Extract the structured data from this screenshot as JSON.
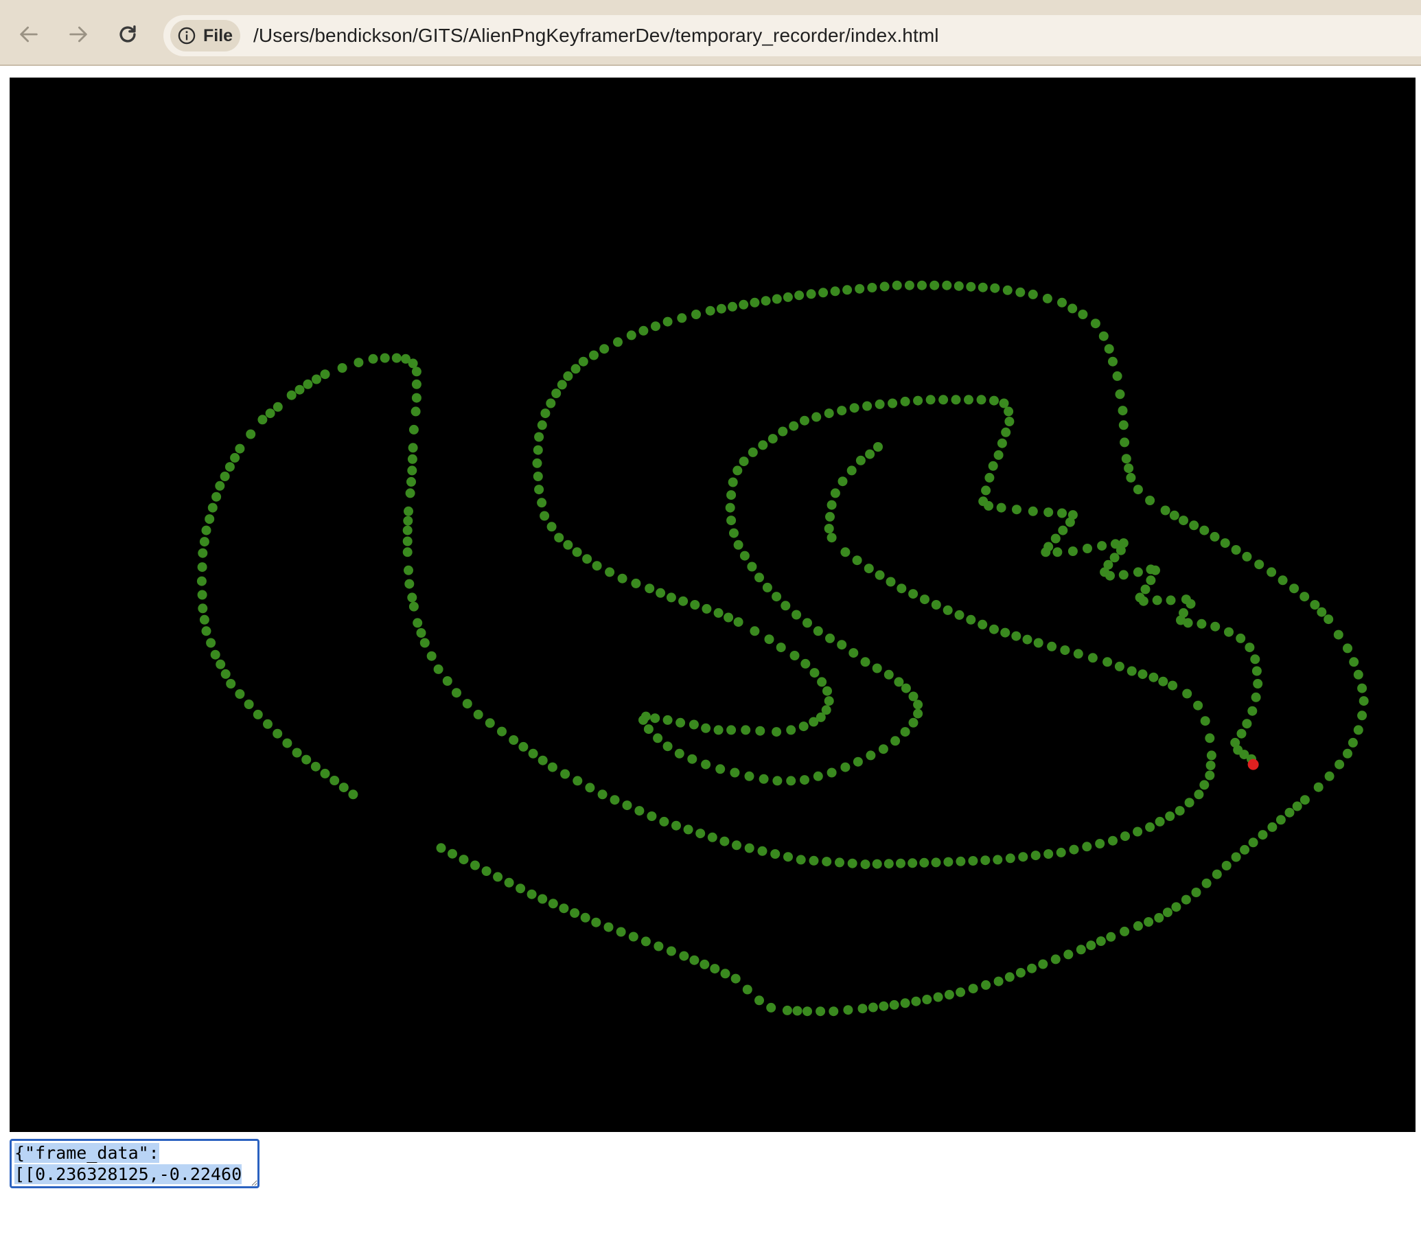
{
  "browser": {
    "back_icon": "arrow-left-icon",
    "forward_icon": "arrow-right-icon",
    "reload_icon": "reload-icon",
    "site_info_icon": "info-icon",
    "site_info_label": "File",
    "url": "/Users/bendickson/GITS/AlienPngKeyframerDev/temporary_recorder/index.html"
  },
  "canvas": {
    "background": "#000000",
    "trail_color": "#3a8a1f",
    "current_point_color": "#e02020"
  },
  "output": {
    "line1": "{\"frame_data\":",
    "line2": "[[0.236328125,-0.22460"
  }
}
